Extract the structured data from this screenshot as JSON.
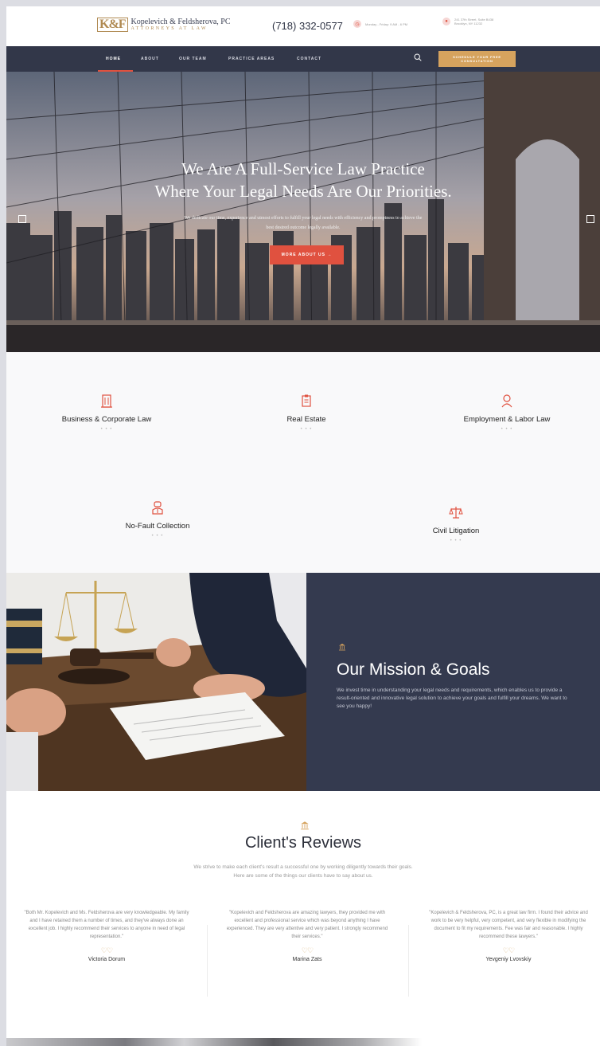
{
  "header": {
    "logo_mark": "K&F",
    "logo_name": "Kopelevich & Feldsherova, PC",
    "logo_sub": "ATTORNEYS AT LAW",
    "phone": "(718) 332-0577",
    "hours": "Monday - Friday: 9 AM - 6 PM",
    "address_line1": "241 37th Street, Suite B438",
    "address_line2": "Brooklyn, NY 11232"
  },
  "nav": {
    "items": [
      {
        "label": "HOME"
      },
      {
        "label": "ABOUT"
      },
      {
        "label": "OUR TEAM"
      },
      {
        "label": "PRACTICE AREAS"
      },
      {
        "label": "CONTACT"
      }
    ],
    "cta_line1": "SCHEDULE YOUR FREE",
    "cta_line2": "CONSULTATION"
  },
  "hero": {
    "title_line1": "We Are A Full-Service Law Practice",
    "title_line2": "Where Your Legal Needs Are Our Priorities.",
    "subtitle": "We dedicate our time, experience and utmost efforts to fulfill your legal needs with efficiency and promptness to achieve the best desired outcome legally available.",
    "button": "MORE ABOUT US →"
  },
  "practice_areas": [
    {
      "label": "Business & Corporate Law",
      "dots": "• • •"
    },
    {
      "label": "Real Estate",
      "dots": "• • •"
    },
    {
      "label": "Employment & Labor Law",
      "dots": "• • •"
    },
    {
      "label": "No-Fault Collection",
      "dots": "• • •"
    },
    {
      "label": "Civil Litigation",
      "dots": "• • •"
    }
  ],
  "mission": {
    "title": "Our Mission & Goals",
    "text": "We invest time in understanding your legal needs and requirements, which enables us to provide a result-oriented and innovative legal solution to achieve your goals and fulfill your dreams. We want to see you happy!"
  },
  "reviews": {
    "title": "Client's Reviews",
    "subtitle_line1": "We strive to make each client's result a successful one by working diligently towards their goals.",
    "subtitle_line2": "Here are some of the things our clients have to say about us.",
    "items": [
      {
        "text": "\"Both Mr. Kopelevich and Ms. Feldsherova are very knowledgeable. My family and I have retained them a number of times, and they've always done an excellent job. I highly recommend their services to anyone in need of legal representation.\"",
        "hearts": "♡♡",
        "name": "Victoria Dorum"
      },
      {
        "text": "\"Kopelevich and Feldsherova are amazing lawyers, they provided me with excellent and professional service which was beyond anything I have experienced. They are very attentive and very patient. I strongly recommend their services.\"",
        "hearts": "♡♡",
        "name": "Marina Zats"
      },
      {
        "text": "\"Kopelevich & Feldsherova, PC, is a great law firm. I found their advice and work to be very helpful, very competent, and very flexible in modifying the document to fit my requirements. Fee was fair and reasonable. I highly recommend these lawyers.\"",
        "hearts": "♡♡",
        "name": "Yevgeniy Lvovskiy"
      }
    ]
  },
  "colors": {
    "navy": "#323749",
    "accent_red": "#e0513f",
    "gold": "#d6a35e"
  }
}
